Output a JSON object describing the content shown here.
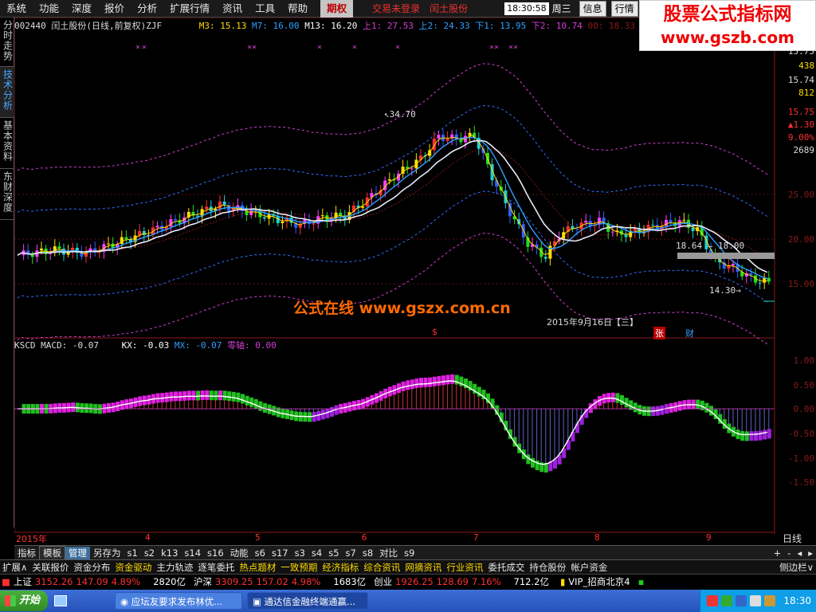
{
  "menubar": {
    "items": [
      "系统",
      "功能",
      "深度",
      "报价",
      "分析",
      "扩展行情",
      "资讯",
      "工具",
      "帮助"
    ],
    "active_tab": "期权",
    "status1": "交易未登录",
    "status2": "闰土股份",
    "clock": "18:30:58",
    "weekday": "周三",
    "btn_info": "信息",
    "btn_quote": "行情"
  },
  "logo": {
    "line1": "股票公式指标网",
    "line2": "www.gszb.com"
  },
  "sidetabs": [
    "分时走势",
    "技术分析",
    "基本资料",
    "东财深度"
  ],
  "main_info": {
    "code_name": "002440 闰土股份(日线,前复权)ZJF",
    "m3": "M3: 15.13",
    "m7": "M7: 16.00",
    "m13": "M13: 16.20",
    "up1": "上1: 27.53",
    "up2": "上2: 24.33",
    "down1": "下1: 13.95",
    "down2": "下2: 10.74",
    "extra": "00: 18.33"
  },
  "price_axis": {
    "labels": [
      "15.75",
      "438",
      "15.74",
      "812",
      "15.75",
      "▲1.30",
      "9.00%",
      "2689",
      "25.00",
      "20.00",
      "15.00"
    ]
  },
  "annotations": {
    "high": "34.70",
    "mid": "18.64 — 18.00",
    "low": "14.30",
    "date": "2015年9月16日【三】",
    "watermark": "公式在线  www.gszx.com.cn",
    "zhang": "张",
    "cai": "财",
    "dollar": "$"
  },
  "macd_info": {
    "name": "KSCD MACD: -0.07",
    "kx": "KX: -0.03",
    "mx": "MX: -0.07",
    "zero": "零轴: 0.00"
  },
  "macd_axis": [
    "1.00",
    "0.50",
    "0.00",
    "-0.50",
    "-1.00",
    "-1.50"
  ],
  "time_axis": [
    "2015年",
    "4",
    "5",
    "6",
    "7",
    "8",
    "9"
  ],
  "period": "日线",
  "tabbar": [
    "指标",
    "模板",
    "管理",
    "另存为",
    "s1",
    "s2",
    "k13",
    "s14",
    "s16",
    "动能",
    "s6",
    "s17",
    "s3",
    "s4",
    "s5",
    "s7",
    "s8",
    "对比",
    "s9"
  ],
  "linkbar": [
    "扩展",
    "关联报价",
    "资金分布",
    "资金驱动",
    "主力轨迹",
    "逐笔委托",
    "热点题材",
    "一致预期",
    "经济指标",
    "综合资讯",
    "网摘资讯",
    "行业资讯",
    "委托成交",
    "持仓股份",
    "帐户资金"
  ],
  "linkbar_right": "侧边栏",
  "indexbar": {
    "sh_label": "上证",
    "sh_value": "3152.26",
    "sh_change": "147.09",
    "sh_pct": "4.89%",
    "sh_vol": "2820亿",
    "hs_label": "沪深",
    "hs_value": "3309.25",
    "hs_change": "157.02",
    "hs_pct": "4.98%",
    "hs_vol": "1683亿",
    "cy_label": "创业",
    "cy_value": "1926.25",
    "cy_change": "128.69",
    "cy_pct": "7.16%",
    "cy_vol": "712.2亿",
    "vip": "VIP_招商北京4"
  },
  "taskbar": {
    "start": "开始",
    "task1": "应坛友要求发布林优...",
    "task2": "通达信金融终端通赢...",
    "time": "18:30"
  },
  "colors": {
    "up": "#ff3030",
    "down": "#20d0d0",
    "magenta": "#d040d0",
    "yellow": "#ffdd00",
    "white": "#ffffff"
  }
}
